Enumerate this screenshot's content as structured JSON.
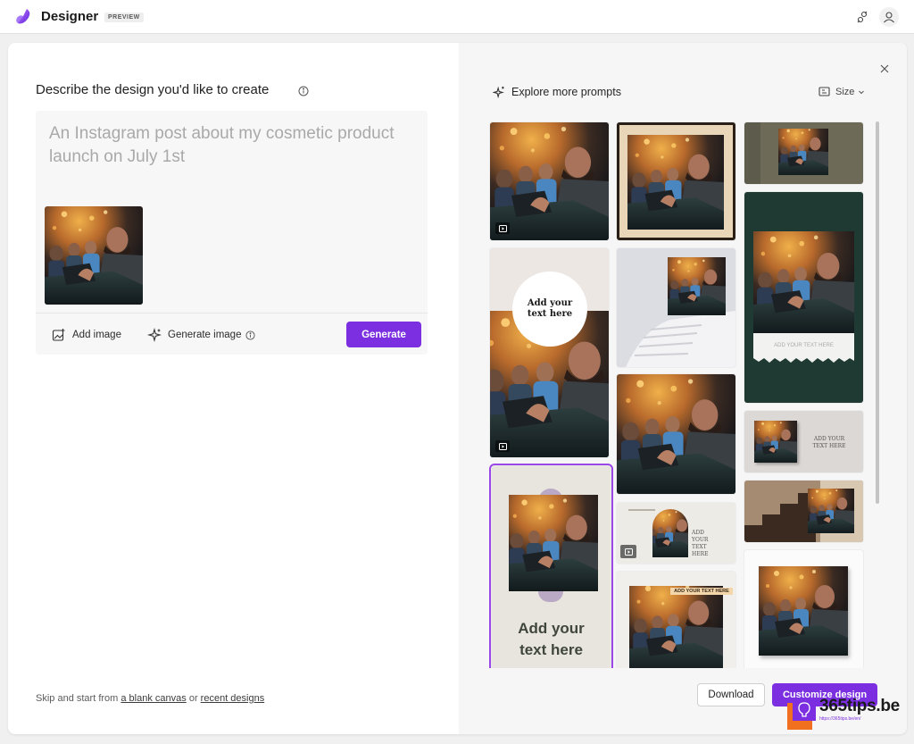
{
  "app": {
    "title": "Designer",
    "badge": "PREVIEW"
  },
  "left": {
    "heading": "Describe the design you'd like to create",
    "prompt_placeholder": "An Instagram post about my cosmetic product launch on July 1st",
    "add_image_label": "Add image",
    "generate_image_label": "Generate image",
    "generate_button": "Generate",
    "footer": {
      "prefix": "Skip and start from ",
      "blank_canvas": "a blank canvas",
      "middle": " or ",
      "recent_designs": "recent designs"
    }
  },
  "right": {
    "explore_label": "Explore more prompts",
    "size_label": "Size",
    "download_button": "Download",
    "customize_button": "Customize design",
    "tiles": {
      "t4_text": "Add your text here",
      "t5_text": "ADD YOUR TEXT HERE",
      "t7_text": "Add your text here",
      "t9_text": "ADD YOUR TEXT HERE",
      "t10_text": "ADD YOUR TEXT HERE",
      "t13_text": "ADD YOUR TEXT HERE"
    }
  },
  "watermark": {
    "text": "365tips.be",
    "url": "https://365tips.be/en/"
  },
  "colors": {
    "accent": "#7b2fe0",
    "selection": "#9b47e8",
    "dark_green": "#1f3a33"
  },
  "icons": [
    "designer-logo-icon",
    "share-icon",
    "user-icon",
    "info-icon",
    "add-image-icon",
    "sparkle-icon",
    "close-icon",
    "size-icon",
    "chevron-down-icon",
    "video-icon",
    "lightbulb-icon"
  ]
}
